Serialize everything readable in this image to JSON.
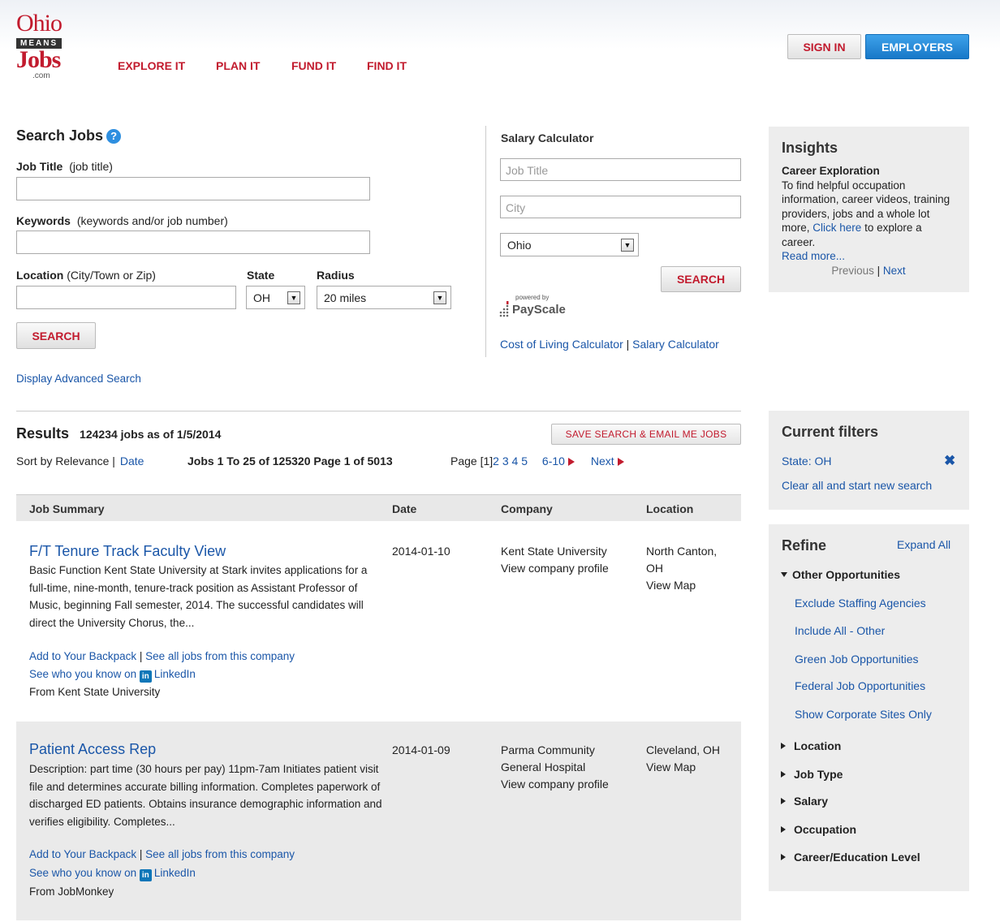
{
  "header": {
    "logo": {
      "ohio": "Ohio",
      "means": "MEANS",
      "jobs": "Jobs",
      "com": ".com"
    },
    "nav": [
      "EXPLORE IT",
      "PLAN IT",
      "FUND IT",
      "FIND IT"
    ],
    "sign_in": "SIGN IN",
    "employers": "EMPLOYERS"
  },
  "search_jobs": {
    "title": "Search Jobs",
    "job_title_label": "Job Title",
    "job_title_hint": "(job title)",
    "keywords_label": "Keywords",
    "keywords_hint": "(keywords and/or job number)",
    "location_label": "Location",
    "location_hint": "(City/Town or Zip)",
    "state_label": "State",
    "state_value": "OH",
    "radius_label": "Radius",
    "radius_value": "20 miles",
    "search_button": "SEARCH",
    "advanced_link": "Display Advanced Search"
  },
  "salary_calculator": {
    "title": "Salary Calculator",
    "job_title_placeholder": "Job Title",
    "city_placeholder": "City",
    "state_value": "Ohio",
    "search_button": "SEARCH",
    "powered_by": "powered by",
    "payscale": "PayScale",
    "cost_of_living_link": "Cost of Living Calculator",
    "separator": "|",
    "salary_calc_link": "Salary Calculator"
  },
  "insights": {
    "title": "Insights",
    "subtitle": "Career Exploration",
    "text_before": "To find helpful occupation information, career videos, training providers, jobs and a whole lot more,",
    "click_here": "Click here",
    "text_after": "to explore a career.",
    "read_more": "Read more...",
    "previous": "Previous",
    "separator": "|",
    "next": "Next"
  },
  "results": {
    "title": "Results",
    "count_text": "124234 jobs as of 1/5/2014",
    "save_button": "SAVE SEARCH & EMAIL ME JOBS",
    "sort_by": "Sort by Relevance",
    "sort_separator": "|",
    "sort_date": "Date",
    "jobs_range": "Jobs 1 To 25 of 125320 Page 1 of 5013",
    "page_label": "Page",
    "current_page": "[1]",
    "pages": [
      "2",
      "3",
      "4",
      "5"
    ],
    "range_next": "6-10",
    "next": "Next",
    "columns": [
      "Job Summary",
      "Date",
      "Company",
      "Location"
    ],
    "jobs": [
      {
        "title": "F/T Tenure Track Faculty View",
        "description": "Basic Function Kent State University at Stark invites applications for a full-time, nine-month, tenure-track position as Assistant Professor of Music, beginning Fall semester, 2014. The successful candidates will direct the University Chorus, the...",
        "add_backpack": "Add to Your Backpack",
        "separator": "|",
        "see_all": "See all jobs from this company",
        "see_who": "See who you know on",
        "linkedin": "LinkedIn",
        "from": "From Kent State University",
        "date": "2014-01-10",
        "company": "Kent State University",
        "company_profile": "View company profile",
        "location": "North Canton, OH",
        "view_map": "View Map"
      },
      {
        "title": "Patient Access Rep",
        "description": "Description: part time (30 hours per pay) 11pm-7am Initiates patient visit file and determines accurate billing information. Completes paperwork of discharged ED patients. Obtains insurance demographic information and verifies eligibility. Completes...",
        "add_backpack": "Add to Your Backpack",
        "separator": "|",
        "see_all": "See all jobs from this company",
        "see_who": "See who you know on",
        "linkedin": "LinkedIn",
        "from": "From JobMonkey",
        "date": "2014-01-09",
        "company": "Parma Community General Hospital",
        "company_profile": "View company profile",
        "location": "Cleveland, OH",
        "view_map": "View Map"
      }
    ]
  },
  "current_filters": {
    "title": "Current filters",
    "filter": "State: OH",
    "clear": "Clear all and start new search"
  },
  "refine": {
    "title": "Refine",
    "expand_all": "Expand All",
    "other_opportunities": "Other Opportunities",
    "items": [
      "Exclude Staffing Agencies",
      "Include All - Other",
      "Green Job Opportunities",
      "Federal Job Opportunities",
      "Show Corporate Sites Only"
    ],
    "sections": [
      "Location",
      "Job Type",
      "Salary",
      "Occupation",
      "Career/Education Level"
    ]
  },
  "colors": {
    "brand_red": "#c21b2e",
    "link_blue": "#1a56a8",
    "employers_blue": "#1878c8",
    "panel_gray": "#ededed"
  }
}
